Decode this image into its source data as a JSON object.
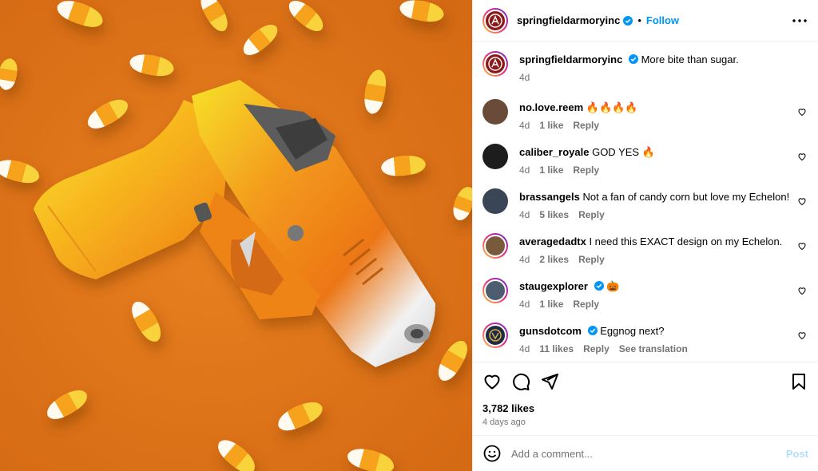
{
  "post": {
    "author": "springfieldarmoryinc",
    "follow_label": "Follow",
    "dot": "•",
    "more_icon": "more-horizontal-icon",
    "caption": {
      "user": "springfieldarmoryinc",
      "text": "More bite than sugar.",
      "time": "4d"
    },
    "comments": [
      {
        "user": "no.love.reem",
        "text": "🔥🔥🔥🔥",
        "time": "4d",
        "likes": "1 like",
        "reply": "Reply",
        "verified": false,
        "avatar_color": "#6a4b3a"
      },
      {
        "user": "caliber_royale",
        "text": "GOD YES 🔥",
        "time": "4d",
        "likes": "1 like",
        "reply": "Reply",
        "verified": false,
        "avatar_color": "#1d1d1d"
      },
      {
        "user": "brassangels",
        "text": "Not a fan of candy corn but love my Echelon!",
        "time": "4d",
        "likes": "5 likes",
        "reply": "Reply",
        "verified": false,
        "avatar_color": "#3a4655"
      },
      {
        "user": "averagedadtx",
        "text": "I need this EXACT design on my Echelon.",
        "time": "4d",
        "likes": "2 likes",
        "reply": "Reply",
        "verified": false,
        "avatar_color": "#7a5a3c"
      },
      {
        "user": "staugexplorer",
        "text": "🎃",
        "time": "4d",
        "likes": "1 like",
        "reply": "Reply",
        "verified": true,
        "avatar_color": "#4b5d6e"
      },
      {
        "user": "gunsdotcom",
        "text": "Eggnog next?",
        "time": "4d",
        "likes": "11 likes",
        "reply": "Reply",
        "translation": "See translation",
        "verified": true,
        "avatar_color": "#1f2a44"
      }
    ],
    "likes_count": "3,782 likes",
    "posted": "4 days ago",
    "add_comment_placeholder": "Add a comment...",
    "post_label": "Post"
  },
  "colors": {
    "accent": "#0095f6",
    "verified": "#0095f6",
    "muted": "#737373",
    "post_disabled": "#b2dffc",
    "background_orange": "#e0771f"
  }
}
